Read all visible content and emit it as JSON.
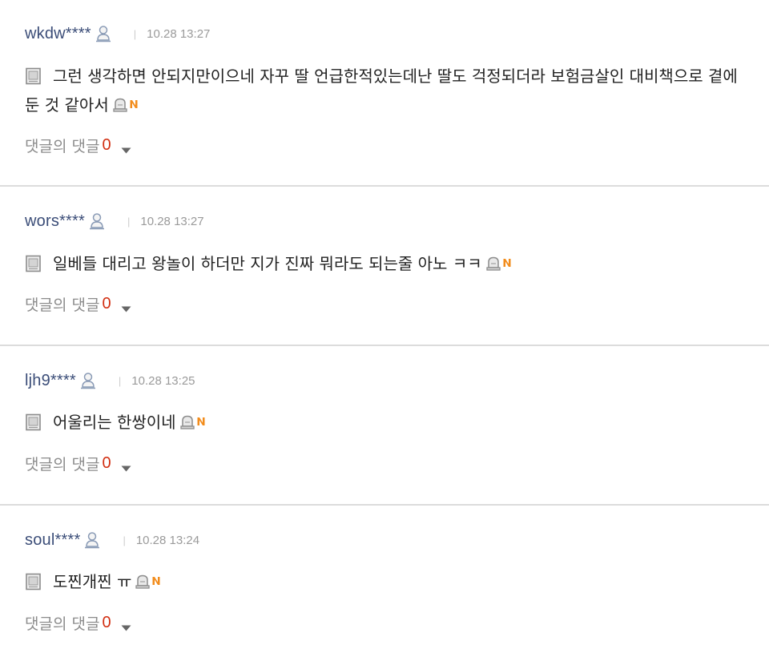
{
  "comments": [
    {
      "username": "wkdw****",
      "timestamp": "10.28 13:27",
      "separator": "|",
      "text": "그런 생각하면 안되지만이으네 자꾸 딸 언급한적있는데난 딸도 걱정되더라 보험금살인 대비책으로 곁에 둔 것 같아서",
      "reply_label": "댓글의 댓글",
      "reply_count": "0"
    },
    {
      "username": "wors****",
      "timestamp": "10.28 13:27",
      "separator": "|",
      "text": "일베들 대리고 왕놀이 하더만 지가 진짜 뭐라도 되는줄 아노 ㅋㅋ",
      "reply_label": "댓글의 댓글",
      "reply_count": "0"
    },
    {
      "username": "ljh9****",
      "timestamp": "10.28 13:25",
      "separator": "|",
      "text": "어울리는 한쌍이네",
      "reply_label": "댓글의 댓글",
      "reply_count": "0"
    },
    {
      "username": "soul****",
      "timestamp": "10.28 13:24",
      "separator": "|",
      "text": "도찐개찐 ㅠ",
      "reply_label": "댓글의 댓글",
      "reply_count": "0"
    }
  ],
  "icons": {
    "user": "user-profile-icon",
    "memo": "memo-icon",
    "alarm": "bell-icon",
    "new": "new-badge-icon",
    "caret": "chevron-down-icon"
  },
  "colors": {
    "username": "#3b4d78",
    "reply_count": "#d22f12",
    "new_badge": "#f28c1c",
    "divider": "#dcdcdc"
  }
}
